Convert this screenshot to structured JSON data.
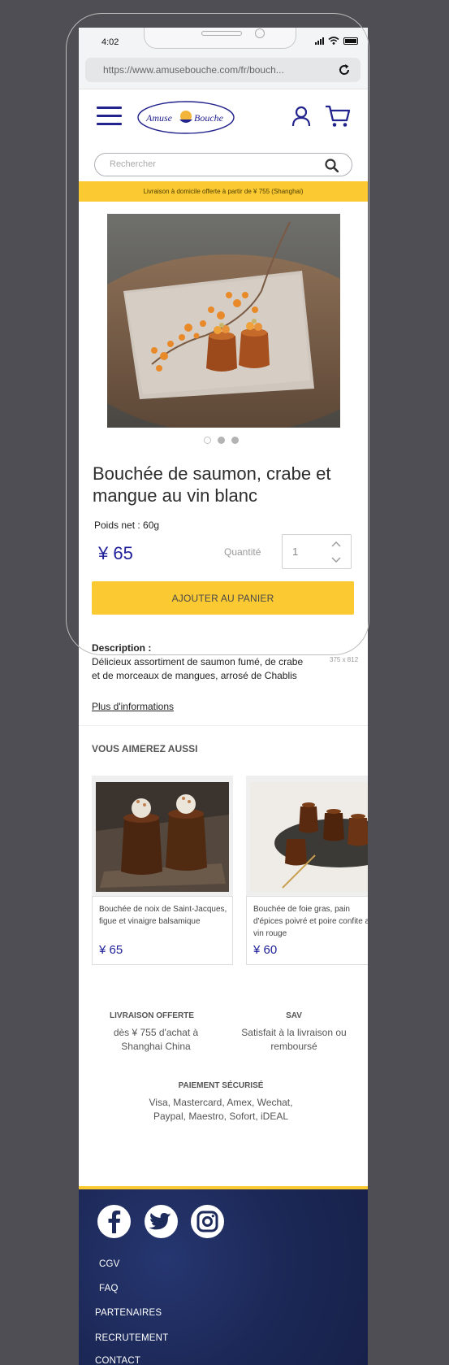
{
  "device": {
    "time": "4:02",
    "url": "https://www.amusebouche.com/fr/bouch...",
    "frame_label": "375 x 812"
  },
  "header": {
    "logo_text_left": "Amuse",
    "logo_text_right": "Bouche",
    "brand_color": "#23238e",
    "accent_color": "#fbc932"
  },
  "search": {
    "placeholder": "Rechercher"
  },
  "promo": {
    "text": "Livraison à domicile offerte à partir de ¥ 755 (Shanghai)"
  },
  "product": {
    "title": "Bouchée de saumon, crabe et mangue au vin blanc",
    "weight": "Poids net : 60g",
    "price": "¥ 65",
    "quantity_label": "Quantité",
    "quantity_value": "1",
    "add_to_cart": "AJOUTER AU PANIER",
    "carousel_active_index": 0,
    "carousel_count": 3,
    "description_label": "Description :",
    "description": "Délicieux  assortiment de saumon fumé, de crabe et de morceaux de mangues, arrosé de Chablis",
    "more_info": "Plus d'informations"
  },
  "related": {
    "title": "VOUS AIMEREZ AUSSI",
    "items": [
      {
        "name": "Bouchée de noix de Saint-Jacques, figue et vinaigre balsamique",
        "price": "¥ 65"
      },
      {
        "name": "Bouchée de foie gras, pain d'épices poivré et poire confite au vin rouge",
        "price": "¥ 60"
      }
    ]
  },
  "features": {
    "delivery_title": "LIVRAISON OFFERTE",
    "delivery_text": "dès ¥ 755 d'achat à Shanghai China",
    "sav_title": "SAV",
    "sav_text": "Satisfait à la livraison ou remboursé",
    "payment_title": "PAIEMENT SÉCURISÉ",
    "payment_text": "Visa, Mastercard, Amex, Wechat, Paypal, Maestro, Sofort, iDEAL"
  },
  "footer": {
    "social": [
      "facebook-icon",
      "twitter-icon",
      "instagram-icon"
    ],
    "links": [
      "CGV",
      "FAQ",
      "PARTENAIRES",
      "RECRUTEMENT",
      "CONTACT"
    ]
  }
}
